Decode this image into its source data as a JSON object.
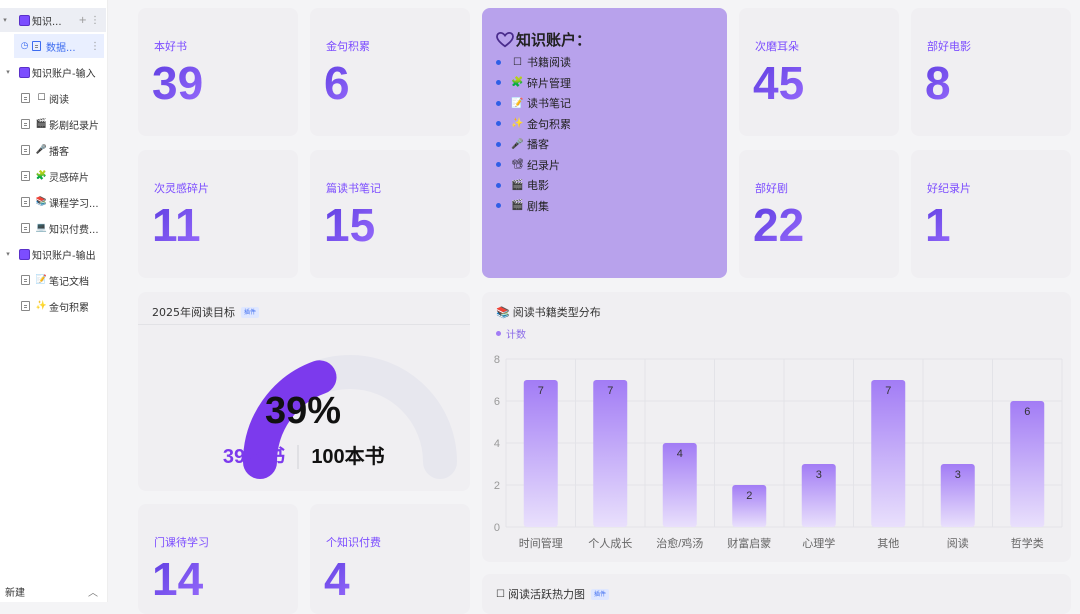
{
  "sidebar": {
    "items": [
      {
        "label": "知识...",
        "icon": "purple-square",
        "caret": "▾",
        "actions": "+ ⋮"
      },
      {
        "label": "数据...",
        "icon": "doc",
        "extra_icon": "clock",
        "actions": "⋮"
      },
      {
        "label": "知识账户-输入",
        "icon": "purple-square",
        "caret": "▾"
      },
      {
        "label": "阅读",
        "icon": "book",
        "emoji": "☐"
      },
      {
        "label": "影剧纪录片",
        "icon": "clapper",
        "emoji": "🎬"
      },
      {
        "label": "播客",
        "icon": "mic",
        "emoji": "🎤"
      },
      {
        "label": "灵感碎片",
        "icon": "puzzle",
        "emoji": "🧩"
      },
      {
        "label": "课程学习...",
        "icon": "books",
        "emoji": "📚"
      },
      {
        "label": "知识付费...",
        "icon": "laptop",
        "emoji": "💻"
      },
      {
        "label": "知识账户-输出",
        "icon": "purple-square",
        "caret": "▾"
      },
      {
        "label": "笔记文档",
        "icon": "memo",
        "emoji": "📝"
      },
      {
        "label": "金句积累",
        "icon": "sparkle",
        "emoji": "✨"
      }
    ],
    "footer": {
      "new_label": "新建",
      "chevron": "︿"
    }
  },
  "stats": [
    {
      "label": "本好书",
      "value": "39"
    },
    {
      "label": "金句积累",
      "value": "6"
    },
    {
      "label": "次磨耳朵",
      "value": "45"
    },
    {
      "label": "部好电影",
      "value": "8"
    },
    {
      "label": "次灵感碎片",
      "value": "11"
    },
    {
      "label": "篇读书笔记",
      "value": "15"
    },
    {
      "label": "部好剧",
      "value": "22"
    },
    {
      "label": "好纪录片",
      "value": "1"
    },
    {
      "label": "门课待学习",
      "value": "14"
    },
    {
      "label": "个知识付费",
      "value": "4"
    }
  ],
  "info_card": {
    "title": "知识账户：",
    "icon": "heart-icon",
    "items": [
      {
        "icon": "☐",
        "label": "书籍阅读"
      },
      {
        "icon": "🧩",
        "label": "碎片管理"
      },
      {
        "icon": "📝",
        "label": "读书笔记"
      },
      {
        "icon": "✨",
        "label": "金句积累"
      },
      {
        "icon": "🎤",
        "label": "播客"
      },
      {
        "icon": "📽",
        "label": "纪录片"
      },
      {
        "icon": "🎬",
        "label": "电影"
      },
      {
        "icon": "🎬",
        "label": "剧集"
      }
    ]
  },
  "goal_panel": {
    "title": "2025年阅读目标",
    "tag": "插件",
    "percent_label": "39%",
    "progress": 0.39,
    "current_label": "39本书",
    "target_label": "100本书",
    "colors": {
      "fill": "#7c3aed",
      "track": "#e7e7ee"
    }
  },
  "chart_panel": {
    "title": "阅读书籍类型分布",
    "legend": "计数"
  },
  "heatmap_panel": {
    "title": "阅读活跃热力图",
    "tag": "插件"
  },
  "chart_data": {
    "type": "bar",
    "categories": [
      "时间管理",
      "个人成长",
      "治愈/鸡汤",
      "财富启蒙",
      "心理学",
      "其他",
      "阅读",
      "哲学类"
    ],
    "series": [
      {
        "name": "计数",
        "values": [
          7,
          7,
          4,
          2,
          3,
          7,
          3,
          6
        ]
      }
    ],
    "ylim": [
      0,
      8
    ],
    "yticks": [
      0,
      2,
      4,
      6,
      8
    ],
    "grid": true,
    "legend_position": "top-left",
    "colors": {
      "bar_top": "#a27cf5",
      "bar_bottom": "#e9e0fc"
    }
  }
}
